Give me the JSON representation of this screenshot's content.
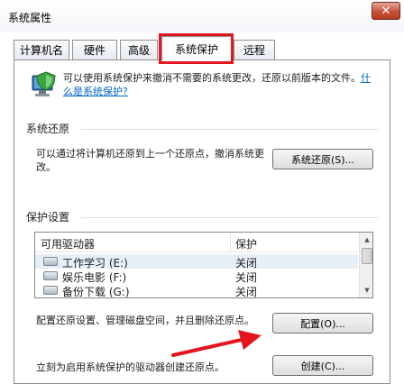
{
  "window": {
    "title": "系统属性",
    "close_glyph": "✕"
  },
  "tabs": [
    {
      "label": "计算机名"
    },
    {
      "label": "硬件"
    },
    {
      "label": "高级"
    },
    {
      "label": "系统保护",
      "active": true
    },
    {
      "label": "远程"
    }
  ],
  "intro": {
    "text": "可以使用系统保护来撤消不需要的系统更改，还原以前版本的文件。",
    "link": "什么是系统保护?"
  },
  "restore": {
    "section_title": "系统还原",
    "description": "可以通过将计算机还原到上一个还原点，撤消系统更改。",
    "button": "系统还原(S)..."
  },
  "protection": {
    "section_title": "保护设置",
    "columns": [
      "可用驱动器",
      "保护"
    ],
    "drives": [
      {
        "name": "工作学习 (E:)",
        "status": "关闭"
      },
      {
        "name": "娱乐电影 (F:)",
        "status": "关闭"
      },
      {
        "name": "备份下载 (G:)",
        "status": "关闭"
      }
    ]
  },
  "configure": {
    "description": "配置还原设置、管理磁盘空间，并且删除还原点。",
    "button": "配置(O)..."
  },
  "create": {
    "description": "立刻为启用系统保护的驱动器创建还原点。",
    "button": "创建(C)..."
  },
  "colors": {
    "highlight_border": "#e4151e",
    "link": "#0066cc",
    "selected_row": "#e6eef6"
  },
  "icons": [
    "computer-shield-icon",
    "drive-icon",
    "scroll-up-icon",
    "scroll-down-icon",
    "close-icon"
  ]
}
